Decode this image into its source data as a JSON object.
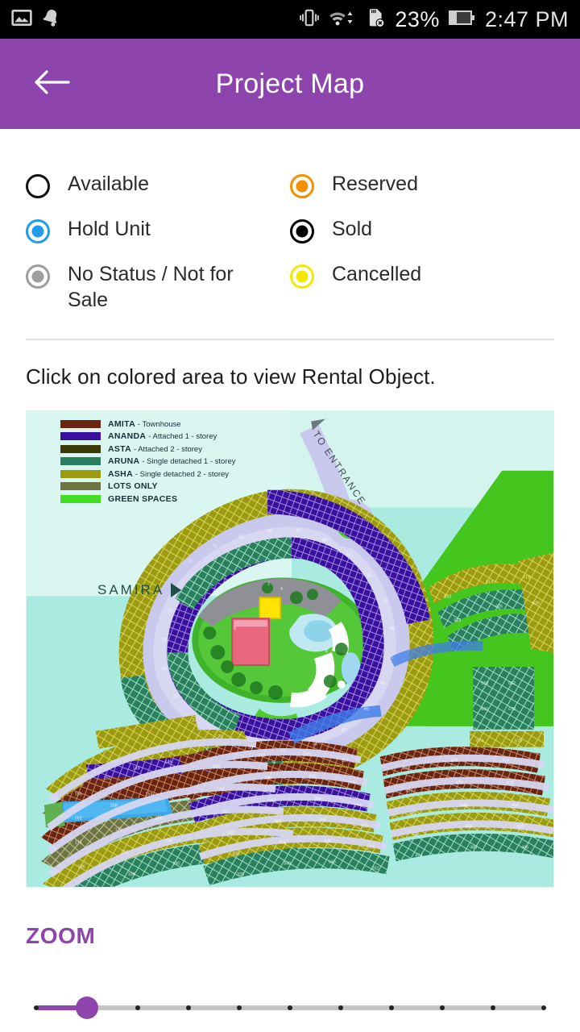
{
  "statusbar": {
    "time": "2:47 PM",
    "battery_percent": "23%",
    "icons": [
      "image-icon",
      "bell-icon",
      "vibrate-icon",
      "wifi-icon",
      "sdcard-error-icon",
      "battery-icon"
    ]
  },
  "appbar": {
    "title": "Project Map",
    "back_icon": "arrow-left-icon",
    "color": "#8e44ad"
  },
  "status_legend": [
    {
      "label": "Available",
      "state": "empty",
      "color": "#111111"
    },
    {
      "label": "Reserved",
      "state": "filled",
      "color": "#f59000"
    },
    {
      "label": "Hold Unit",
      "state": "filled",
      "color": "#229bea"
    },
    {
      "label": "Sold",
      "state": "filled",
      "color": "#000000"
    },
    {
      "label": "No Status / Not for Sale",
      "state": "filled",
      "color": "#9e9e9e"
    },
    {
      "label": "Cancelled",
      "state": "filled",
      "color": "#f5e800"
    }
  ],
  "hint": "Click on colored area to view Rental Object.",
  "map": {
    "background_color": "#a9ebe0",
    "samira_label": "SAMIRA",
    "entrance_label": "TO ENTRANCE",
    "legend": [
      {
        "name": "AMITA",
        "desc": "- Townhouse",
        "color": "#6b2410"
      },
      {
        "name": "ANANDA",
        "desc": "- Attached 1 - storey",
        "color": "#3b0f9e"
      },
      {
        "name": "ASTA",
        "desc": "- Attached 2 - storey",
        "color": "#3b3a08"
      },
      {
        "name": "ARUNA",
        "desc": "- Single detached 1 - storey",
        "color": "#2a7f5e"
      },
      {
        "name": "ASHA",
        "desc": "- Single detached 2 - storey",
        "color": "#9c9a10"
      },
      {
        "name": "LOTS ONLY",
        "desc": "",
        "color": "#6e7342"
      },
      {
        "name": "GREEN SPACES",
        "desc": "",
        "color": "#44dd22"
      }
    ]
  },
  "zoom": {
    "label": "ZOOM",
    "value": 1,
    "min": 0,
    "max": 10,
    "ticks": 11,
    "accent_color": "#8e44ad"
  }
}
